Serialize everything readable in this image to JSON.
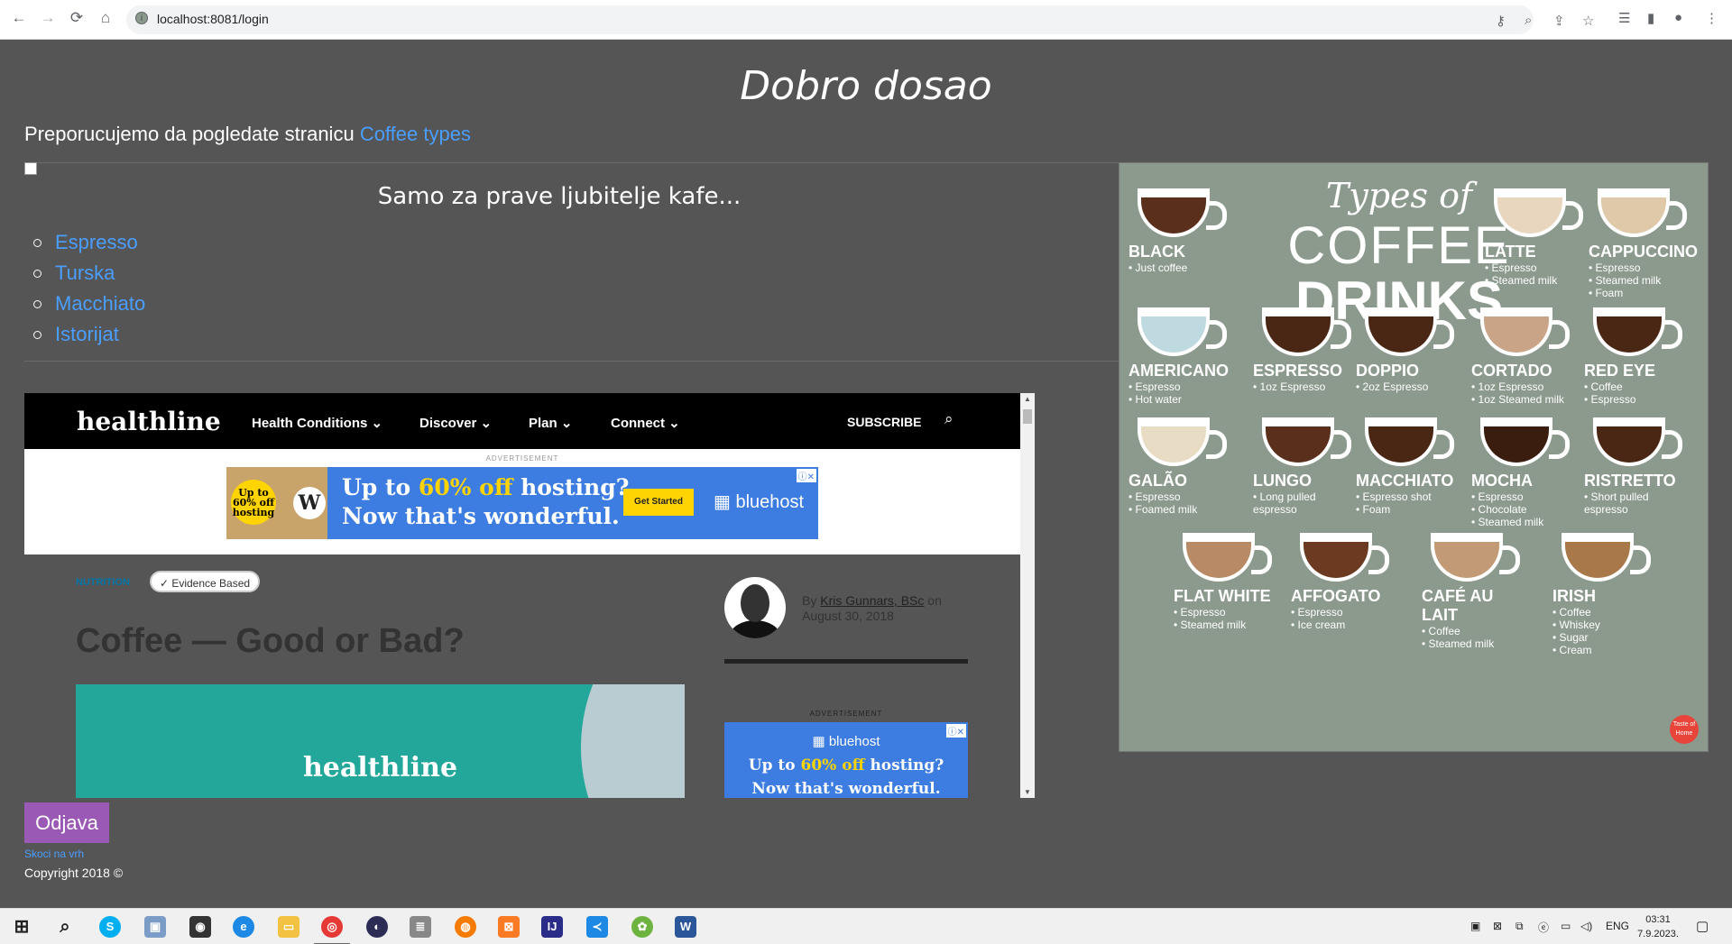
{
  "browser": {
    "url": "localhost:8081/login",
    "back_icon": "arrow-left",
    "forward_icon": "arrow-right",
    "reload_icon": "reload",
    "home_icon": "home"
  },
  "page": {
    "title": "Dobro dosao",
    "recommend_text": "Preporucujemo da pogledate stranicu",
    "recommend_link": "Coffee types",
    "subtitle": "Samo za prave ljubitelje kafe...",
    "coffee_links": [
      "Espresso",
      "Turska",
      "Macchiato",
      "Istorijat"
    ],
    "logout_button": "Odjava",
    "back_to_top": "Skoci na vrh",
    "copyright": "Copyright 2018 ©"
  },
  "embed": {
    "logo": "healthline",
    "nav": [
      "Health Conditions ⌄",
      "Discover ⌄",
      "Plan ⌄",
      "Connect ⌄"
    ],
    "subscribe": "SUBSCRIBE",
    "ad_label": "ADVERTISEMENT",
    "ad_badge": "Up to 60% off hosting",
    "ad_line1_a": "Up to ",
    "ad_line1_b": "60% off",
    "ad_line1_c": " hosting?",
    "ad_line2": "Now that's wonderful.",
    "ad_cta": "Get Started",
    "ad_brand": "bluehost",
    "tag": "NUTRITION",
    "evidence": "✓ Evidence Based",
    "article_title": "Coffee — Good or Bad?",
    "byline_by": "By ",
    "author": "Kris Gunnars, BSc",
    "byline_on": " on",
    "date": "August 30, 2018",
    "hero_logo": "healthline",
    "ad2_brand": "bluehost",
    "ad2_line1_a": "Up to ",
    "ad2_line1_b": "60% off",
    "ad2_line1_c": " hosting?",
    "ad2_line2": "Now that's wonderful."
  },
  "infographic": {
    "title_1": "Types of",
    "title_2": "COFFEE",
    "title_3": "DRINKS",
    "brand": "Taste of Home",
    "drinks": [
      {
        "name": "BLACK",
        "desc": "• Just coffee"
      },
      {
        "name": "LATTE",
        "desc": "• Espresso\n• Steamed milk"
      },
      {
        "name": "CAPPUCCINO",
        "desc": "• Espresso\n• Steamed milk\n• Foam"
      },
      {
        "name": "AMERICANO",
        "desc": "• Espresso\n• Hot water"
      },
      {
        "name": "ESPRESSO",
        "desc": "• 1oz Espresso"
      },
      {
        "name": "DOPPIO",
        "desc": "• 2oz Espresso"
      },
      {
        "name": "CORTADO",
        "desc": "• 1oz Espresso\n• 1oz Steamed milk"
      },
      {
        "name": "RED EYE",
        "desc": "• Coffee\n• Espresso"
      },
      {
        "name": "GALÃO",
        "desc": "• Espresso\n• Foamed milk"
      },
      {
        "name": "LUNGO",
        "desc": "• Long pulled\n  espresso"
      },
      {
        "name": "MACCHIATO",
        "desc": "• Espresso shot\n• Foam"
      },
      {
        "name": "MOCHA",
        "desc": "• Espresso\n• Chocolate\n• Steamed milk"
      },
      {
        "name": "RISTRETTO",
        "desc": "• Short pulled\n  espresso"
      },
      {
        "name": "FLAT WHITE",
        "desc": "• Espresso\n• Steamed milk"
      },
      {
        "name": "AFFOGATO",
        "desc": "• Espresso\n• Ice cream"
      },
      {
        "name": "CAFÉ AU LAIT",
        "desc": "• Coffee\n• Steamed milk"
      },
      {
        "name": "IRISH",
        "desc": "• Coffee\n• Whiskey\n• Sugar\n• Cream"
      }
    ]
  },
  "taskbar": {
    "language": "ENG",
    "time": "03:31",
    "date": "7.9.2023."
  },
  "colors": {
    "page_bg": "#555555",
    "link": "#4a9eff",
    "logout_bg": "#9b59b6",
    "infographic_bg": "#8c9a8e"
  }
}
